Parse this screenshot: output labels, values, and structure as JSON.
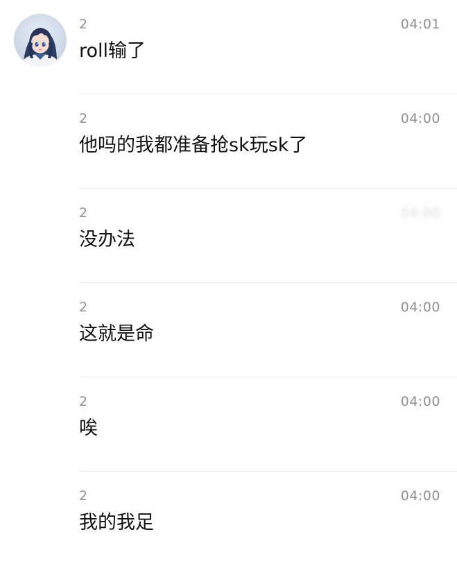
{
  "chat": {
    "messages": [
      {
        "sender": "2",
        "time": "04:01",
        "text": "roll输了",
        "show_avatar": true
      },
      {
        "sender": "2",
        "time": "04:00",
        "text": "他吗的我都准备抢sk玩sk了",
        "show_avatar": false
      },
      {
        "sender": "2",
        "time": "04:00",
        "text": "没办法",
        "show_avatar": false,
        "time_blurred": true
      },
      {
        "sender": "2",
        "time": "04:00",
        "text": "这就是命",
        "show_avatar": false
      },
      {
        "sender": "2",
        "time": "04:00",
        "text": "唉",
        "show_avatar": false
      },
      {
        "sender": "2",
        "time": "04:00",
        "text": "我的我足",
        "show_avatar": false
      }
    ]
  },
  "colors": {
    "meta_text": "#8f8f8f",
    "message_text": "#111111",
    "divider": "#ededed",
    "background": "#ffffff"
  },
  "icons": {
    "avatar": "anime-girl-avatar-icon"
  }
}
